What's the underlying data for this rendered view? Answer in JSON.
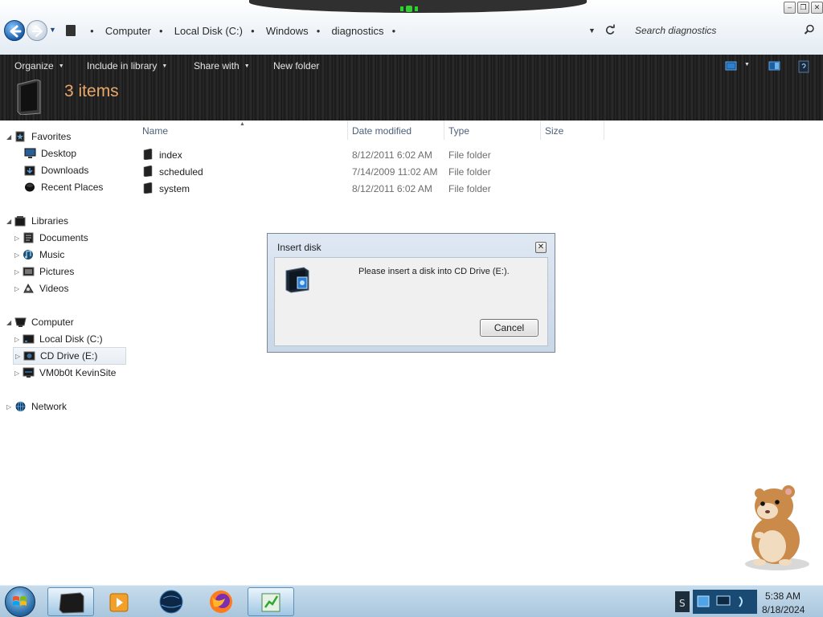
{
  "address_bar": {
    "crumbs": [
      "Computer",
      "Local Disk (C:)",
      "Windows",
      "diagnostics"
    ],
    "search_placeholder": "Search diagnostics"
  },
  "toolbar": {
    "organize": "Organize",
    "include_in_library": "Include in library",
    "share_with": "Share with",
    "new_folder": "New folder",
    "items_count": "3 items"
  },
  "nav_pane": {
    "favorites": {
      "label": "Favorites",
      "items": [
        "Desktop",
        "Downloads",
        "Recent Places"
      ]
    },
    "libraries": {
      "label": "Libraries",
      "items": [
        "Documents",
        "Music",
        "Pictures",
        "Videos"
      ]
    },
    "computer": {
      "label": "Computer",
      "items": [
        "Local Disk (C:)",
        "CD Drive (E:)",
        "VM0b0t KevinSite"
      ]
    },
    "network": {
      "label": "Network"
    }
  },
  "file_list": {
    "columns": [
      "Name",
      "Date modified",
      "Type",
      "Size"
    ],
    "rows": [
      {
        "name": "index",
        "date": "8/12/2011 6:02 AM",
        "type": "File folder",
        "size": ""
      },
      {
        "name": "scheduled",
        "date": "7/14/2009 11:02 AM",
        "type": "File folder",
        "size": ""
      },
      {
        "name": "system",
        "date": "8/12/2011 6:02 AM",
        "type": "File folder",
        "size": ""
      }
    ]
  },
  "dialog": {
    "title": "Insert disk",
    "message": "Please insert a disk into CD Drive (E:).",
    "cancel": "Cancel"
  },
  "taskbar": {
    "time": "5:38 AM",
    "date": "8/18/2024"
  },
  "colors": {
    "toolbar_bg": "#1e1e1e",
    "items_count": "#e8a86a",
    "taskbar_bg": "#b8d2e6"
  }
}
